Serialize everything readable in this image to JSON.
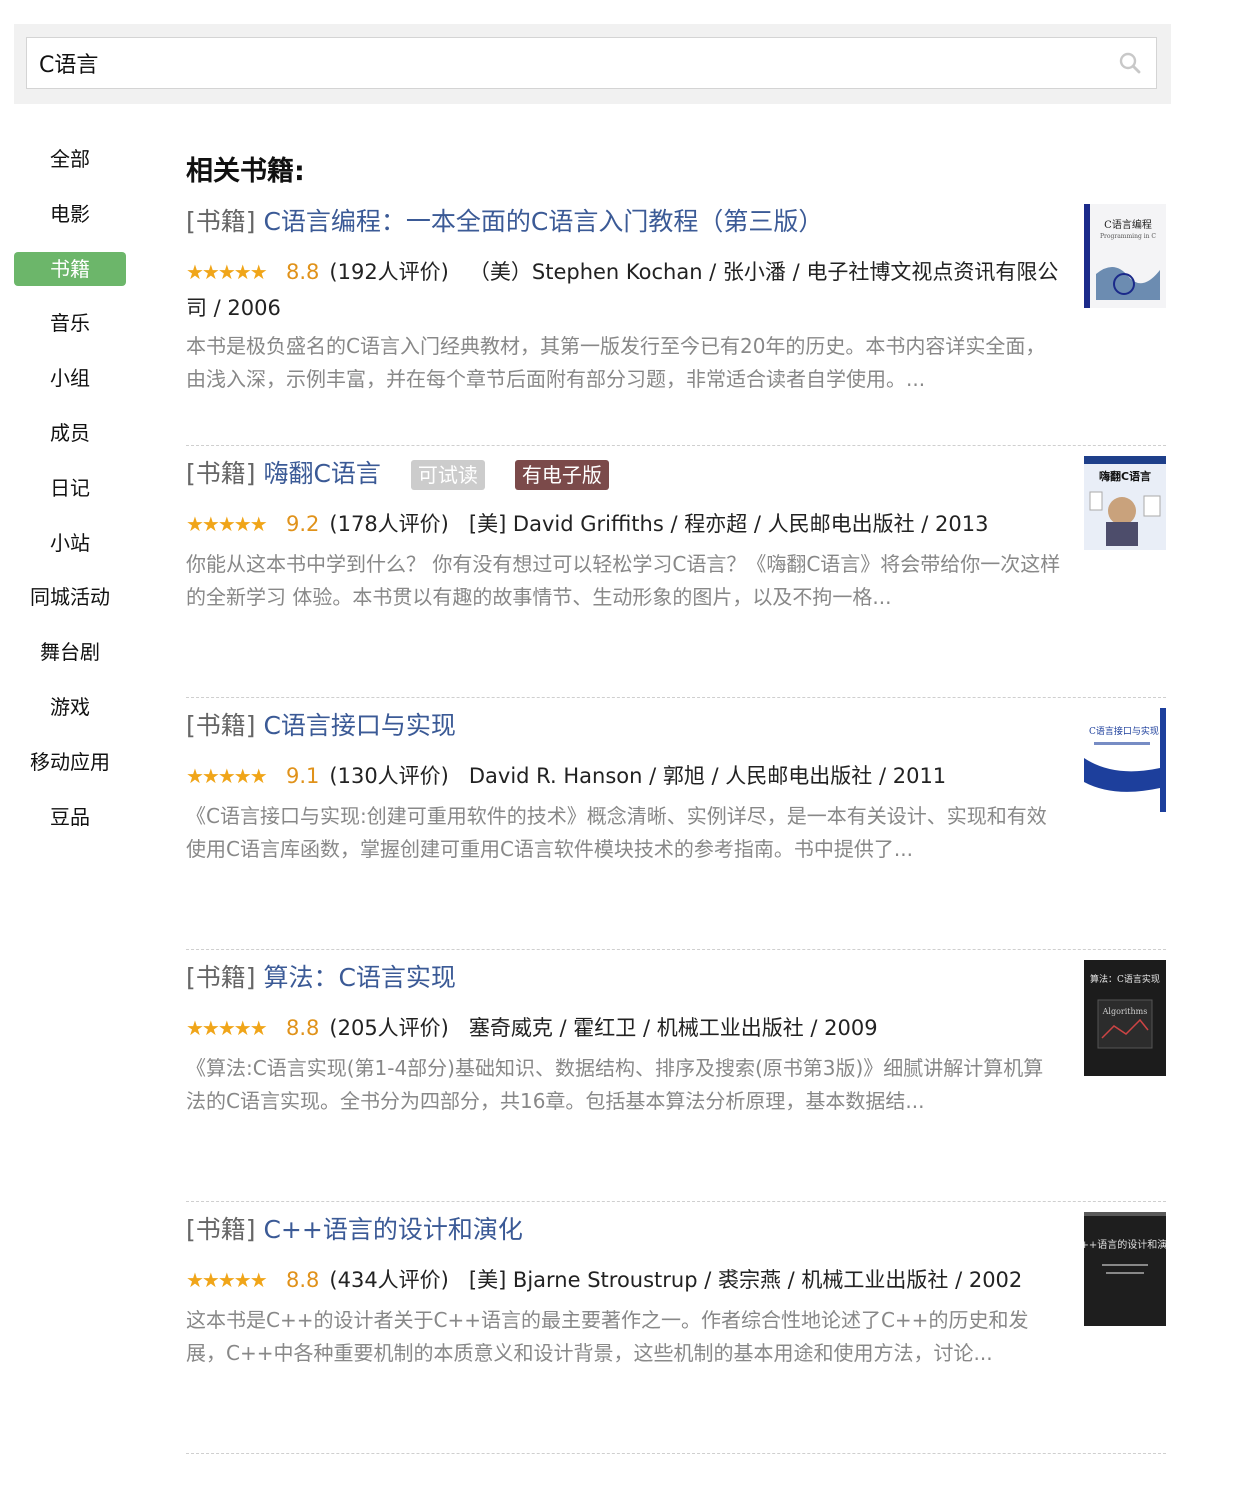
{
  "search": {
    "value": "C语言"
  },
  "sidebar": {
    "items": [
      {
        "label": "全部"
      },
      {
        "label": "电影"
      },
      {
        "label": "书籍",
        "active": true
      },
      {
        "label": "音乐"
      },
      {
        "label": "小组"
      },
      {
        "label": "成员"
      },
      {
        "label": "日记"
      },
      {
        "label": "小站"
      },
      {
        "label": "同城活动"
      },
      {
        "label": "舞台剧"
      },
      {
        "label": "游戏"
      },
      {
        "label": "移动应用"
      },
      {
        "label": "豆品"
      }
    ]
  },
  "main": {
    "section_title": "相关书籍:",
    "results": [
      {
        "tag": "[书籍]",
        "title": "C语言编程：一本全面的C语言入门教程（第三版）",
        "rating": "8.8",
        "rating_count": "(192人评价)",
        "stars": 4.5,
        "meta": "（美）Stephen Kochan / 张小潘 / 电子社博文视点资讯有限公司 / 2006",
        "description": "本书是极负盛名的C语言入门经典教材，其第一版发行至今已有20年的历史。本书内容详实全面，由浅入深，示例丰富，并在每个章节后面附有部分习题，非常适合读者自学使用。...",
        "cover_title": "C语言编程",
        "cover_sub": "Programming in C"
      },
      {
        "tag": "[书籍]",
        "title": "嗨翻C语言",
        "badges": [
          "可试读",
          "有电子版"
        ],
        "rating": "9.2",
        "rating_count": "(178人评价)",
        "stars": 4.5,
        "meta": "[美] David Griffiths / 程亦超 / 人民邮电出版社 / 2013",
        "description": "你能从这本书中学到什么？ 你有没有想过可以轻松学习C语言？《嗨翻C语言》将会带给你一次这样的全新学习 体验。本书贯以有趣的故事情节、生动形象的图片，以及不拘一格...",
        "cover_title": "嗨翻C语言",
        "cover_sub": ""
      },
      {
        "tag": "[书籍]",
        "title": "C语言接口与实现",
        "rating": "9.1",
        "rating_count": "(130人评价)",
        "stars": 4.5,
        "meta": "David R. Hanson / 郭旭 / 人民邮电出版社 / 2011",
        "description": "《C语言接口与实现:创建可重用软件的技术》概念清晰、实例详尽，是一本有关设计、实现和有效使用C语言库函数，掌握创建可重用C语言软件模块技术的参考指南。书中提供了...",
        "cover_title": "C语言接口与实现",
        "cover_sub": ""
      },
      {
        "tag": "[书籍]",
        "title": "算法：C语言实现",
        "rating": "8.8",
        "rating_count": "(205人评价)",
        "stars": 4.5,
        "meta": "塞奇威克 / 霍红卫 / 机械工业出版社 / 2009",
        "description": "《算法:C语言实现(第1-4部分)基础知识、数据结构、排序及搜索(原书第3版)》细腻讲解计算机算法的C语言实现。全书分为四部分，共16章。包括基本算法分析原理，基本数据结...",
        "cover_title": "算法：C语言实现",
        "cover_sub": "Algorithms"
      },
      {
        "tag": "[书籍]",
        "title": "C++语言的设计和演化",
        "rating": "8.8",
        "rating_count": "(434人评价)",
        "stars": 4.5,
        "meta": "[美] Bjarne Stroustrup / 裘宗燕 / 机械工业出版社 / 2002",
        "description": "这本书是C++的设计者关于C++语言的最主要著作之一。作者综合性地论述了C++的历史和发展，C++中各种重要机制的本质意义和设计背景，这些机制的基本用途和使用方法，讨论...",
        "cover_title": "C++语言的设计和演化",
        "cover_sub": ""
      }
    ]
  },
  "colors": {
    "accent_green": "#6cb66a",
    "link_blue": "#3b5a96",
    "star_orange": "#f0a519",
    "ebook_badge": "#7b4a4a"
  }
}
